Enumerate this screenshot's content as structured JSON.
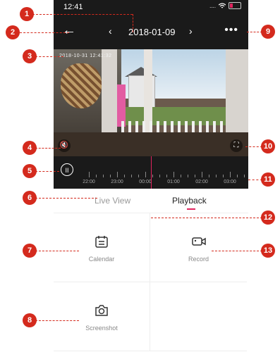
{
  "status": {
    "time": "12:41",
    "signal": "....",
    "wifi": "wifi"
  },
  "nav": {
    "back_icon": "arrow-left-icon",
    "prev": "‹",
    "date": "2018-01-09",
    "next": "›",
    "more": "•••"
  },
  "video": {
    "timestamp": "2018-10-31 12:41:32"
  },
  "timeline": {
    "labels": [
      "22:00",
      "23:00",
      "00:00",
      "01:00",
      "02:00",
      "03:00"
    ]
  },
  "tabs": {
    "live_view": "Live View",
    "playback": "Playback",
    "active": "Playback"
  },
  "actions": {
    "calendar": "Calendar",
    "record": "Record",
    "screenshot": "Screenshot"
  },
  "callouts": [
    "1",
    "2",
    "3",
    "4",
    "5",
    "6",
    "7",
    "8",
    "9",
    "10",
    "11",
    "12",
    "13"
  ],
  "colors": {
    "accent": "#e0245e",
    "callout": "#d42a1d"
  }
}
